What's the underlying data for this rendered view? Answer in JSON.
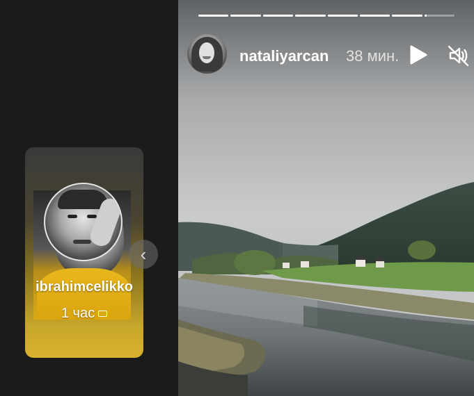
{
  "previous_story": {
    "username": "ibrahimcelikko",
    "time": "1 час",
    "nav_icon": "chevron-left-icon"
  },
  "current_story": {
    "username": "nataliyarcan",
    "time": "38 мин.",
    "progress": {
      "segments": 8,
      "completed": 7,
      "current_fraction": 0.08
    },
    "controls": {
      "play_icon": "play-icon",
      "mute_icon": "speaker-muted-icon"
    }
  },
  "colors": {
    "background": "#1b1b1b",
    "card_accent": "#d9b22e",
    "text": "#ffffff"
  }
}
